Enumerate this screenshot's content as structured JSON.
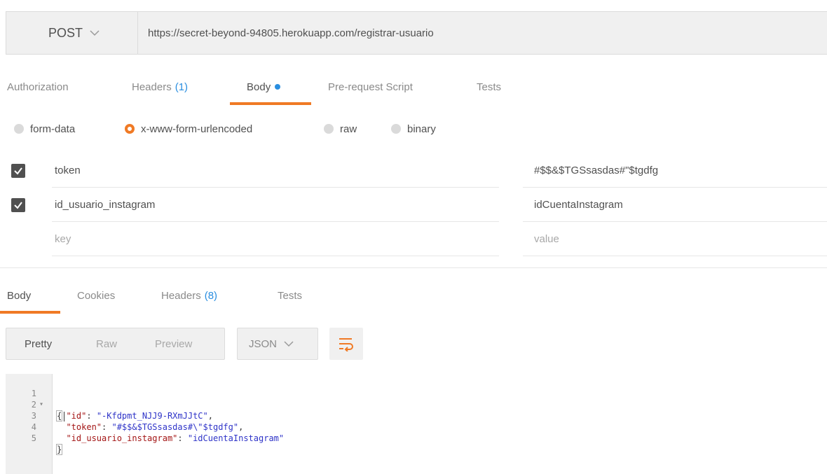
{
  "request": {
    "method": "POST",
    "url": "https://secret-beyond-94805.herokuapp.com/registrar-usuario"
  },
  "request_tabs": [
    {
      "label": "Authorization"
    },
    {
      "label": "Headers",
      "count": "(1)"
    },
    {
      "label": "Body"
    },
    {
      "label": "Pre-request Script"
    },
    {
      "label": "Tests"
    }
  ],
  "body_types": [
    "form-data",
    "x-www-form-urlencoded",
    "raw",
    "binary"
  ],
  "params": [
    {
      "key": "token",
      "value": "#$$&$TGSsasdas#\"$tgdfg"
    },
    {
      "key": "id_usuario_instagram",
      "value": "idCuentaInstagram"
    }
  ],
  "placeholders": {
    "key": "key",
    "value": "value"
  },
  "response_tabs": [
    {
      "label": "Body"
    },
    {
      "label": "Cookies"
    },
    {
      "label": "Headers",
      "count": "(8)"
    },
    {
      "label": "Tests"
    }
  ],
  "view_modes": [
    "Pretty",
    "Raw",
    "Preview"
  ],
  "format": "JSON",
  "response_code": {
    "line_numbers": [
      "1",
      "2",
      "3",
      "4",
      "5"
    ],
    "open_brace": "{",
    "close_brace": "}",
    "fields": [
      {
        "key": "\"id\"",
        "value": "\"-Kfdpmt_NJJ9-RXmJJtC\""
      },
      {
        "key": "\"token\"",
        "value": "\"#$$&$TGSsasdas#\\\"$tgdfg\""
      },
      {
        "key": "\"id_usuario_instagram\"",
        "value": "\"idCuentaInstagram\""
      }
    ]
  },
  "colors": {
    "accent": "#f07a25",
    "count_blue": "#2a8ee0",
    "json_key": "#a31515",
    "json_string": "#2f34c8"
  }
}
